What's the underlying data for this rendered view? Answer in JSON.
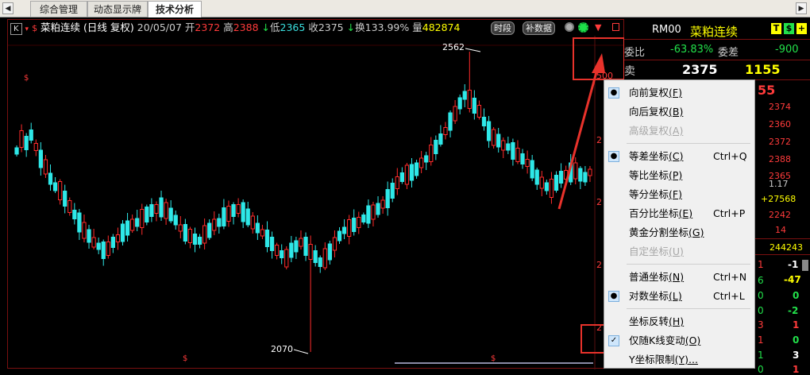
{
  "tabs": {
    "items": [
      "综合管理",
      "动态显示牌",
      "技术分析"
    ],
    "active_index": 2
  },
  "chart_header": {
    "period_label": "K",
    "name": "菜粕连续",
    "period": "(日线 复权)",
    "date": "20/05/07",
    "open_label": "开",
    "open": "2372",
    "high_label": "高",
    "high": "2388",
    "low_label": "低",
    "low": "2365",
    "close_label": "收",
    "close": "2375",
    "turnover_label": "换",
    "turnover": "133.99%",
    "volume_label": "量",
    "volume": "482874",
    "chip_time": "时段",
    "chip_data": "补数据"
  },
  "chart_data": {
    "type": "candlestick",
    "annotations": [
      {
        "label": "2562"
      },
      {
        "label": "2070"
      }
    ],
    "axis_labels": [
      "500",
      "2",
      "2",
      "2",
      "2"
    ]
  },
  "quote_panel": {
    "code": "RM00",
    "name": "菜粕连续",
    "btn_t": "T",
    "btn_dollar": "$",
    "btn_plus": "+",
    "weibi_label": "委比",
    "weibi_value": "-63.83%",
    "weicha_label": "委差",
    "weicha_value": "-900",
    "sell_label": "卖",
    "sell_price": "2375",
    "sell_qty": "1155",
    "row3_value": "55",
    "right_values": [
      "2374",
      "2360",
      "2372",
      "2388",
      "2365",
      "1.17",
      "+27568",
      "2242",
      "14"
    ],
    "total_value": "244243",
    "tick_left": [
      "1",
      "6",
      "0",
      "0",
      "3",
      "1",
      "1",
      "0"
    ],
    "tick_right": [
      "-1",
      "-47",
      "0",
      "-2",
      "1",
      "0",
      "3",
      "1"
    ],
    "colors": {
      "red": "#ff3b3b",
      "green": "#22e04a",
      "yellow": "#ffff00",
      "cyan": "#3ae0e0",
      "white": "#ffffff"
    }
  },
  "context_menu": {
    "items": [
      {
        "label": "向前复权",
        "key": "(F)",
        "shortcut": "",
        "checked": "dot",
        "disabled": false
      },
      {
        "label": "向后复权",
        "key": "(B)",
        "shortcut": "",
        "checked": "",
        "disabled": false
      },
      {
        "label": "高级复权",
        "key": "(A)",
        "shortcut": "",
        "checked": "",
        "disabled": true
      },
      {
        "label": "等差坐标",
        "key": "(C)",
        "shortcut": "Ctrl+Q",
        "checked": "dot",
        "disabled": false
      },
      {
        "label": "等比坐标",
        "key": "(P)",
        "shortcut": "",
        "checked": "",
        "disabled": false
      },
      {
        "label": "等分坐标",
        "key": "(F)",
        "shortcut": "",
        "checked": "",
        "disabled": false
      },
      {
        "label": "百分比坐标",
        "key": "(E)",
        "shortcut": "Ctrl+P",
        "checked": "",
        "disabled": false
      },
      {
        "label": "黄金分割坐标",
        "key": "(G)",
        "shortcut": "",
        "checked": "",
        "disabled": false
      },
      {
        "label": "自定坐标",
        "key": "(U)",
        "shortcut": "",
        "checked": "",
        "disabled": true
      },
      {
        "label": "普通坐标",
        "key": "(N)",
        "shortcut": "Ctrl+N",
        "checked": "",
        "disabled": false
      },
      {
        "label": "对数坐标",
        "key": "(L)",
        "shortcut": "Ctrl+L",
        "checked": "dot",
        "disabled": false
      },
      {
        "label": "坐标反转",
        "key": "(H)",
        "shortcut": "",
        "checked": "",
        "disabled": false
      },
      {
        "label": "仅随K线变动",
        "key": "(O)",
        "shortcut": "",
        "checked": "check",
        "disabled": false
      },
      {
        "label": "Y坐标限制",
        "key": "(Y)...",
        "shortcut": "",
        "checked": "",
        "disabled": false
      }
    ]
  }
}
